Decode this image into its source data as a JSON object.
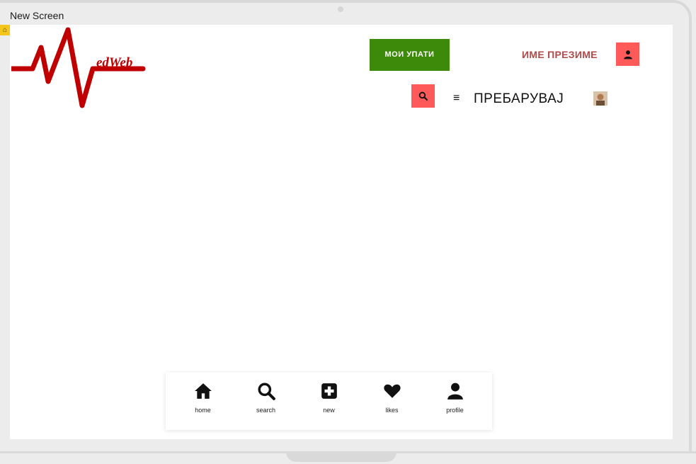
{
  "window": {
    "title": "New Screen"
  },
  "logo": {
    "text": "edWeb",
    "color": "#c00000"
  },
  "header": {
    "referrals_button": "МОИ УПАТИ",
    "user_name": "ИМЕ ПРЕЗИМЕ",
    "search_label": "ПРЕБАРУВАЈ",
    "icons": [
      "user-icon",
      "search-icon",
      "menu-icon",
      "avatar"
    ]
  },
  "colors": {
    "accent_green": "#3d8a0a",
    "accent_red": "#ff5a5a",
    "name_color": "#b04a4a"
  },
  "bottom_nav": {
    "items": [
      {
        "label": "home",
        "icon": "home-icon"
      },
      {
        "label": "search",
        "icon": "search-icon"
      },
      {
        "label": "new",
        "icon": "plus-square-icon"
      },
      {
        "label": "likes",
        "icon": "heart-icon"
      },
      {
        "label": "profile",
        "icon": "user-icon"
      }
    ]
  }
}
